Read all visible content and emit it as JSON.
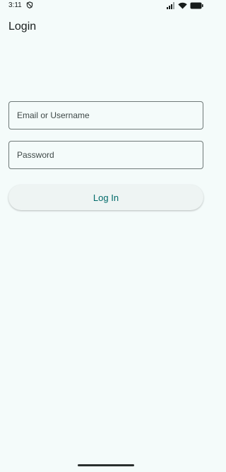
{
  "status_bar": {
    "time": "3:11",
    "left_icon": "vpn-shield-icon",
    "right_icons": [
      "signal-icon",
      "wifi-icon",
      "battery-icon"
    ]
  },
  "page": {
    "title": "Login"
  },
  "form": {
    "email": {
      "placeholder": "Email or Username",
      "value": ""
    },
    "password": {
      "placeholder": "Password",
      "value": ""
    },
    "submit_label": "Log In"
  },
  "colors": {
    "background": "#F4FBFA",
    "accent": "#006A69",
    "outline": "#6F7978",
    "button_surface": "#EEF4F3"
  }
}
